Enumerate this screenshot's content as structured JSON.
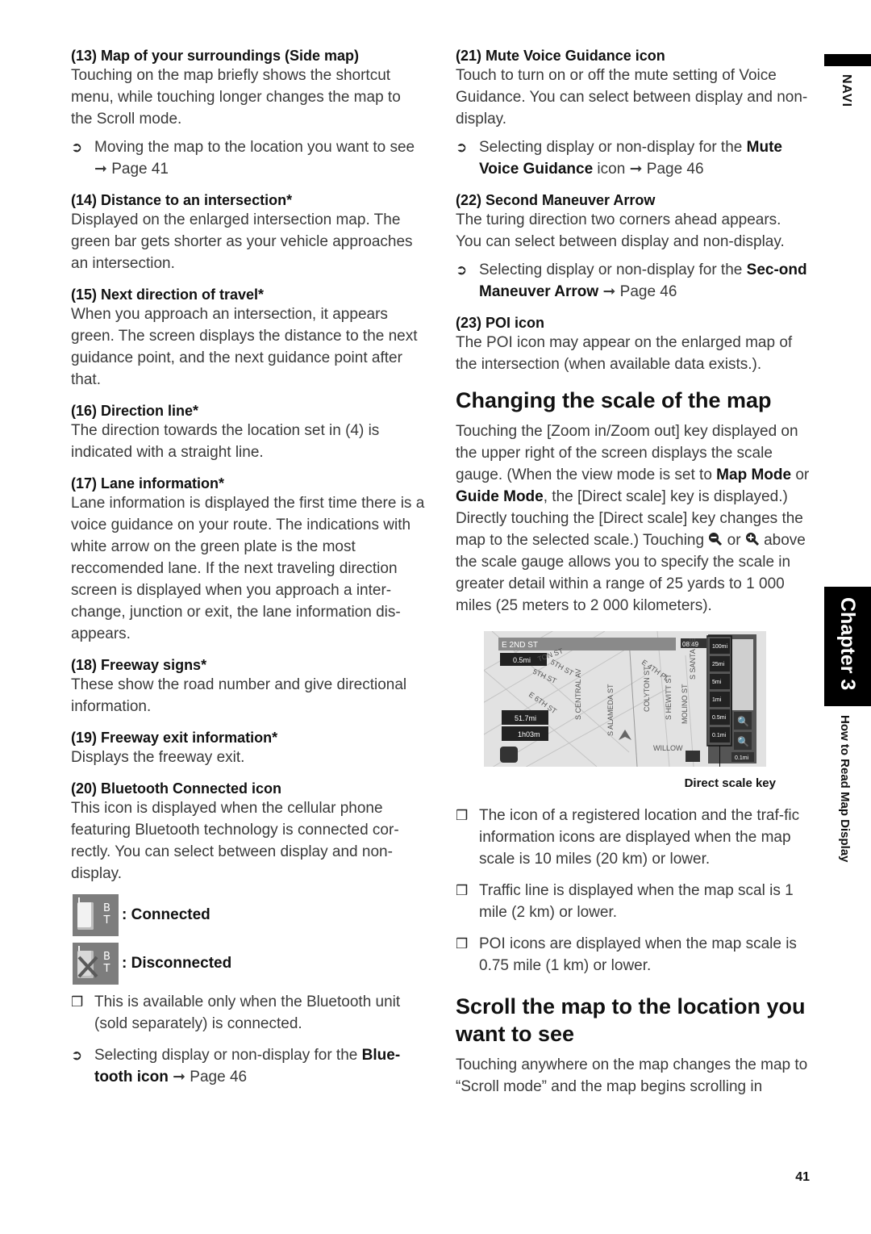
{
  "side": {
    "navi_label": "NAVI",
    "chapter_label": "Chapter 3",
    "chapter_title": "How to Read Map Display"
  },
  "page_number": "41",
  "left": {
    "s13": {
      "title": "(13) Map of your surroundings (Side map)",
      "body": "Touching on the map briefly shows the shortcut menu, while touching longer changes the map to the Scroll mode.",
      "ref_text": "Moving the map to the location you want to see",
      "ref_arrow": "➞",
      "ref_page": "Page 41"
    },
    "s14": {
      "title": "(14) Distance to an intersection*",
      "body": "Displayed on the enlarged intersection map. The green bar gets shorter as your vehicle approaches an intersection."
    },
    "s15": {
      "title": "(15) Next direction of travel*",
      "body": "When you approach an intersection, it appears green. The screen displays the distance to the next guidance point, and the next guidance point after that."
    },
    "s16": {
      "title": "(16) Direction line*",
      "body": "The direction towards the location set in (4) is indicated with a straight line."
    },
    "s17": {
      "title": "(17) Lane information*",
      "body": "Lane information is displayed the first time there is a voice guidance on your route. The indications with white arrow on the green plate is the most reccomended lane. If the next traveling direction screen is displayed when you approach a inter-change, junction or exit, the lane information dis-appears."
    },
    "s18": {
      "title": "(18) Freeway signs*",
      "body": "These show the road number and give directional information."
    },
    "s19": {
      "title": "(19) Freeway exit information*",
      "body": "Displays the freeway exit."
    },
    "s20": {
      "title": "(20) Bluetooth Connected icon",
      "body": "This icon is displayed when the cellular phone featuring Bluetooth technology is connected cor-rectly. You can select between display and non-display.",
      "icon_letters": "B\nT",
      "connected_label": ": Connected",
      "disconnected_label": ": Disconnected",
      "note": "This is available only when the Bluetooth unit (sold separately) is connected.",
      "ref_prefix": "Selecting display or non-display for the ",
      "ref_bold": "Blue-tooth icon",
      "ref_arrow": "➞",
      "ref_page": "Page 46"
    }
  },
  "right": {
    "s21": {
      "title": "(21) Mute Voice Guidance icon",
      "body": "Touch to turn on or off the mute setting of Voice Guidance. You can select between display and non-display.",
      "ref_prefix": "Selecting display or non-display for the ",
      "ref_bold": "Mute Voice Guidance",
      "ref_suffix": " icon",
      "ref_arrow": "➞",
      "ref_page": "Page 46"
    },
    "s22": {
      "title": "(22) Second Maneuver Arrow",
      "body": "The turing direction two corners ahead appears. You can select between display and non-display.",
      "ref_prefix": "Selecting display or non-display for the ",
      "ref_bold": "Sec-ond Maneuver Arrow",
      "ref_arrow": "➞",
      "ref_page": "Page 46"
    },
    "s23": {
      "title": "(23) POI icon",
      "body": "The POI icon may appear on the enlarged map of the intersection (when available data exists.)."
    },
    "scale": {
      "heading": "Changing the scale of the map",
      "p1": "Touching the [Zoom in/Zoom out] key displayed on the upper right of the screen displays the scale gauge. (When the view mode is set to ",
      "b1": "Map Mode",
      "p2": " or ",
      "b2": "Guide Mode",
      "p3": ", the [Direct scale] key is displayed.) Directly touching the [Direct scale] key changes the map to the selected scale.) Touching ",
      "p4": " or ",
      "p5": " above the scale gauge allows you to specify the scale in greater detail within a range of 25 yards to 1 000 miles (25 meters to 2 000 kilometers).",
      "figure": {
        "street_bar": "E 2ND ST",
        "dist_next": "0.5mi",
        "clock": "08:49",
        "dist_total": "51.7mi",
        "time_total": "1h03m",
        "scale_keys": [
          "100mi",
          "25mi",
          "5mi",
          "1mi",
          "0.5mi",
          "0.1mi"
        ],
        "scale_current": "0.1mi",
        "streets": [
          "TON ST",
          "5TH ST",
          "5TH ST",
          "E 6TH ST",
          "S CENTRAL AV",
          "S ALAMEDA ST",
          "E 4TH PL",
          "COLYTON ST",
          "S HEWITT ST",
          "S SANTA FE",
          "MOLINO ST",
          "WILLOW"
        ],
        "caption": "Direct scale key"
      },
      "notes": [
        "The icon of a registered location and the traf-fic information icons are displayed when the map scale is 10 miles (20 km) or lower.",
        "Traffic line is displayed when the map scal is 1 mile (2 km) or lower.",
        "POI icons are displayed when the map scale is 0.75 mile (1 km) or lower."
      ]
    },
    "scroll": {
      "heading": "Scroll the map to the location you want to see",
      "body": "Touching anywhere on the map changes the map to “Scroll mode” and the map begins scrolling in"
    }
  },
  "markers": {
    "ref": "➲",
    "note": "❒"
  }
}
